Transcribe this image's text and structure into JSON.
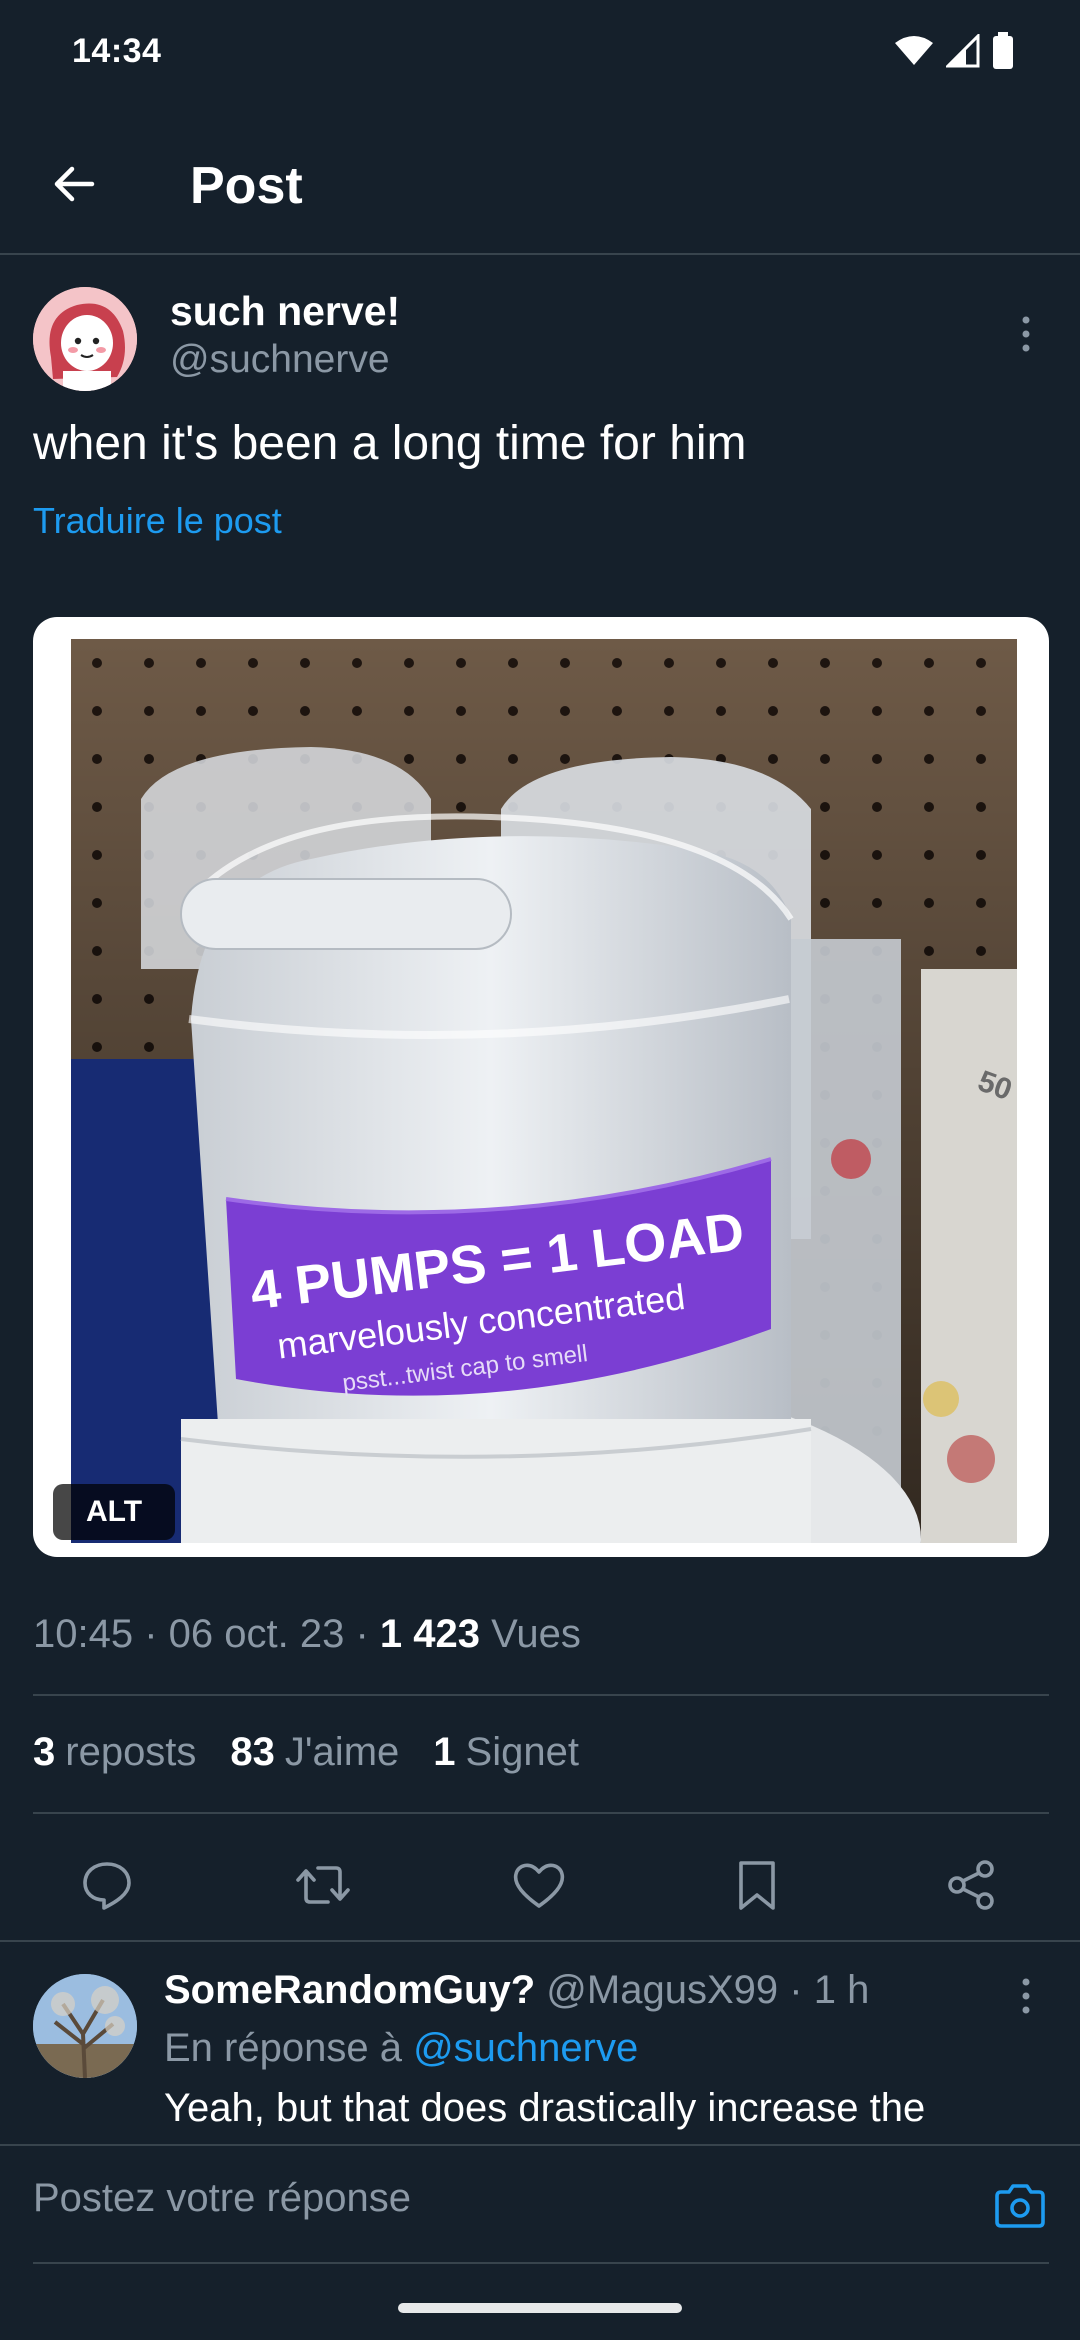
{
  "status_bar": {
    "time": "14:34"
  },
  "header": {
    "title": "Post"
  },
  "post": {
    "display_name": "such nerve!",
    "handle": "@suchnerve",
    "text": "when it's been a long time for him",
    "translate_label": "Traduire le post",
    "media": {
      "alt_badge": "ALT",
      "photo_text": {
        "line1": "4 PUMPS = 1 LOAD",
        "line2": "marvelously concentrated",
        "line3": "psst...twist cap to smell",
        "corner": "50"
      }
    },
    "meta": {
      "time": "10:45",
      "date": "06 oct. 23",
      "views_count": "1 423",
      "views_label": "Vues"
    },
    "stats": {
      "reposts_count": "3",
      "reposts_label": "reposts",
      "likes_count": "83",
      "likes_label": "J'aime",
      "bookmarks_count": "1",
      "bookmarks_label": "Signet"
    }
  },
  "reply": {
    "display_name": "SomeRandomGuy?",
    "handle": "@MagusX99",
    "time": "1 h",
    "context_prefix": "En réponse à",
    "context_mention": "@suchnerve",
    "text": "Yeah, but that does drastically increase the"
  },
  "compose": {
    "placeholder": "Postez votre réponse"
  },
  "colors": {
    "background": "#15202b",
    "accent": "#1d9bf0",
    "muted": "#8b98a5",
    "divider": "#38444d"
  }
}
